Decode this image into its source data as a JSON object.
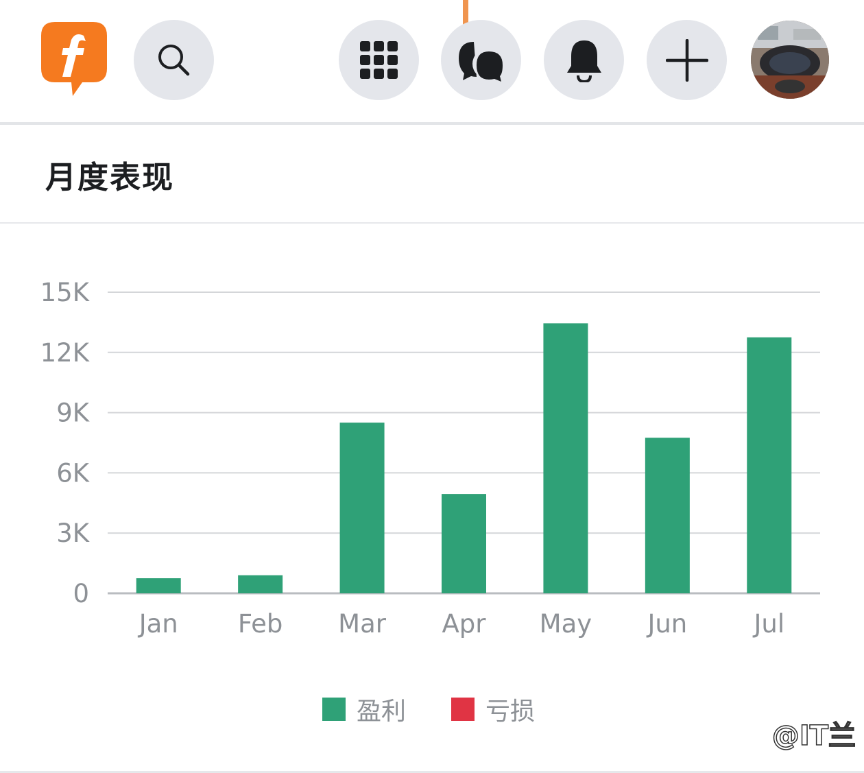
{
  "header": {
    "buttons": [
      "search",
      "menu",
      "messenger",
      "notifications",
      "create"
    ]
  },
  "section": {
    "title": "月度表现"
  },
  "colors": {
    "profit": "#2fa177",
    "loss": "#e03444",
    "brand": "#f57a1f"
  },
  "chart_data": {
    "type": "bar",
    "categories": [
      "Jan",
      "Feb",
      "Mar",
      "Apr",
      "May",
      "Jun",
      "Jul"
    ],
    "series": [
      {
        "name": "盈利",
        "values": [
          750,
          900,
          8500,
          4950,
          13450,
          7750,
          12750
        ]
      },
      {
        "name": "亏损",
        "values": [
          0,
          0,
          0,
          0,
          0,
          0,
          0
        ]
      }
    ],
    "yticks": [
      "0",
      "3K",
      "6K",
      "9K",
      "12K",
      "15K"
    ],
    "ylim": [
      0,
      15000
    ],
    "grid": true,
    "legend": "bottom-center"
  },
  "legend": {
    "profit": "盈利",
    "loss": "亏损"
  },
  "watermark": "@IT兰"
}
